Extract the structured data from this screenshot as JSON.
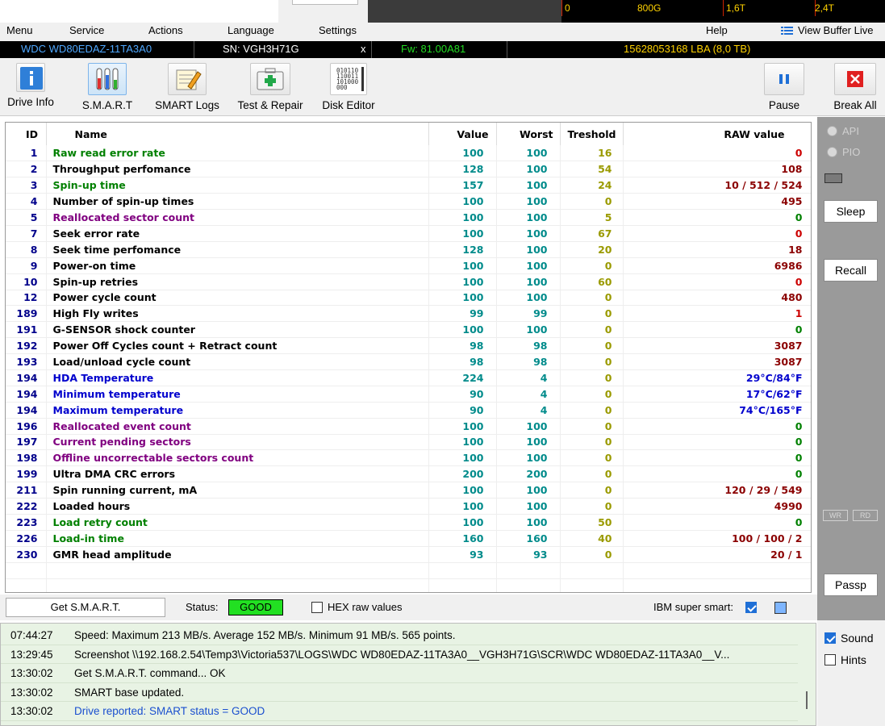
{
  "graph_ticks": [
    "0",
    "800G",
    "1,6T",
    "2,4T"
  ],
  "menu": {
    "items": [
      "Menu",
      "Service",
      "Actions",
      "Language",
      "Settings",
      "Help"
    ],
    "view_buffer": "View Buffer Live"
  },
  "drive": {
    "model": "WDC WD80EDAZ-11TA3A0",
    "sn": "SN: VGH3H71G",
    "close": "x",
    "fw": "Fw: 81.00A81",
    "lba": "15628053168 LBA (8,0 TB)"
  },
  "toolbar": {
    "drive_info": "Drive Info",
    "smart": "S.M.A.R.T",
    "smart_logs": "SMART Logs",
    "test_repair": "Test & Repair",
    "disk_editor": "Disk Editor",
    "pause": "Pause",
    "break_all": "Break All"
  },
  "table": {
    "headers": {
      "id": "ID",
      "name": "Name",
      "value": "Value",
      "worst": "Worst",
      "threshold": "Treshold",
      "raw": "RAW value"
    },
    "rows": [
      {
        "id": "1",
        "name": "Raw read error rate",
        "value": "100",
        "worst": "100",
        "thr": "16",
        "raw": "0",
        "name_color": "#008000",
        "raw_color": "#cc0000"
      },
      {
        "id": "2",
        "name": "Throughput perfomance",
        "value": "128",
        "worst": "100",
        "thr": "54",
        "raw": "108",
        "name_color": "#000000",
        "raw_color": "#8b0000"
      },
      {
        "id": "3",
        "name": "Spin-up time",
        "value": "157",
        "worst": "100",
        "thr": "24",
        "raw": "10 / 512 / 524",
        "name_color": "#008000",
        "raw_color": "#8b0000"
      },
      {
        "id": "4",
        "name": "Number of spin-up times",
        "value": "100",
        "worst": "100",
        "thr": "0",
        "raw": "495",
        "name_color": "#000000",
        "raw_color": "#8b0000"
      },
      {
        "id": "5",
        "name": "Reallocated sector count",
        "value": "100",
        "worst": "100",
        "thr": "5",
        "raw": "0",
        "name_color": "#800080",
        "raw_color": "#008000"
      },
      {
        "id": "7",
        "name": "Seek error rate",
        "value": "100",
        "worst": "100",
        "thr": "67",
        "raw": "0",
        "name_color": "#000000",
        "raw_color": "#cc0000"
      },
      {
        "id": "8",
        "name": "Seek time perfomance",
        "value": "128",
        "worst": "100",
        "thr": "20",
        "raw": "18",
        "name_color": "#000000",
        "raw_color": "#8b0000"
      },
      {
        "id": "9",
        "name": "Power-on time",
        "value": "100",
        "worst": "100",
        "thr": "0",
        "raw": "6986",
        "name_color": "#000000",
        "raw_color": "#8b0000"
      },
      {
        "id": "10",
        "name": "Spin-up retries",
        "value": "100",
        "worst": "100",
        "thr": "60",
        "raw": "0",
        "name_color": "#000000",
        "raw_color": "#cc0000"
      },
      {
        "id": "12",
        "name": "Power cycle count",
        "value": "100",
        "worst": "100",
        "thr": "0",
        "raw": "480",
        "name_color": "#000000",
        "raw_color": "#8b0000"
      },
      {
        "id": "189",
        "name": "High Fly writes",
        "value": "99",
        "worst": "99",
        "thr": "0",
        "raw": "1",
        "name_color": "#000000",
        "raw_color": "#cc0000"
      },
      {
        "id": "191",
        "name": "G-SENSOR shock counter",
        "value": "100",
        "worst": "100",
        "thr": "0",
        "raw": "0",
        "name_color": "#000000",
        "raw_color": "#008000"
      },
      {
        "id": "192",
        "name": "Power Off Cycles count + Retract count",
        "value": "98",
        "worst": "98",
        "thr": "0",
        "raw": "3087",
        "name_color": "#000000",
        "raw_color": "#8b0000"
      },
      {
        "id": "193",
        "name": "Load/unload cycle count",
        "value": "98",
        "worst": "98",
        "thr": "0",
        "raw": "3087",
        "name_color": "#000000",
        "raw_color": "#8b0000"
      },
      {
        "id": "194",
        "name": "HDA Temperature",
        "value": "224",
        "worst": "4",
        "thr": "0",
        "raw": "29°C/84°F",
        "name_color": "#0000cd",
        "raw_color": "#0000cd"
      },
      {
        "id": "194",
        "name": "Minimum temperature",
        "value": "90",
        "worst": "4",
        "thr": "0",
        "raw": "17°C/62°F",
        "name_color": "#0000cd",
        "raw_color": "#0000cd"
      },
      {
        "id": "194",
        "name": "Maximum temperature",
        "value": "90",
        "worst": "4",
        "thr": "0",
        "raw": "74°C/165°F",
        "name_color": "#0000cd",
        "raw_color": "#0000cd"
      },
      {
        "id": "196",
        "name": "Reallocated event count",
        "value": "100",
        "worst": "100",
        "thr": "0",
        "raw": "0",
        "name_color": "#800080",
        "raw_color": "#008000"
      },
      {
        "id": "197",
        "name": "Current pending sectors",
        "value": "100",
        "worst": "100",
        "thr": "0",
        "raw": "0",
        "name_color": "#800080",
        "raw_color": "#008000"
      },
      {
        "id": "198",
        "name": "Offline uncorrectable sectors count",
        "value": "100",
        "worst": "100",
        "thr": "0",
        "raw": "0",
        "name_color": "#800080",
        "raw_color": "#008000"
      },
      {
        "id": "199",
        "name": "Ultra DMA CRC errors",
        "value": "200",
        "worst": "200",
        "thr": "0",
        "raw": "0",
        "name_color": "#000000",
        "raw_color": "#008000"
      },
      {
        "id": "211",
        "name": "Spin running current, mA",
        "value": "100",
        "worst": "100",
        "thr": "0",
        "raw": "120 / 29 / 549",
        "name_color": "#000000",
        "raw_color": "#8b0000"
      },
      {
        "id": "222",
        "name": "Loaded hours",
        "value": "100",
        "worst": "100",
        "thr": "0",
        "raw": "4990",
        "name_color": "#000000",
        "raw_color": "#8b0000"
      },
      {
        "id": "223",
        "name": "Load retry count",
        "value": "100",
        "worst": "100",
        "thr": "50",
        "raw": "0",
        "name_color": "#008000",
        "raw_color": "#008000"
      },
      {
        "id": "226",
        "name": "Load-in time",
        "value": "160",
        "worst": "160",
        "thr": "40",
        "raw": "100 / 100 / 2",
        "name_color": "#008000",
        "raw_color": "#8b0000"
      },
      {
        "id": "230",
        "name": "GMR head amplitude",
        "value": "93",
        "worst": "93",
        "thr": "0",
        "raw": "20 / 1",
        "name_color": "#000000",
        "raw_color": "#8b0000"
      }
    ]
  },
  "right": {
    "api": "API",
    "pio": "PIO",
    "sleep": "Sleep",
    "recall": "Recall",
    "wr": "WR",
    "rd": "RD",
    "passp": "Passp"
  },
  "status": {
    "get_smart": "Get S.M.A.R.T.",
    "status_label": "Status:",
    "status_value": "GOOD",
    "hex_raw": "HEX raw values",
    "ibm": "IBM super smart:"
  },
  "log": [
    {
      "time": "07:44:27",
      "msg": "Speed: Maximum 213 MB/s. Average 152 MB/s. Minimum 91 MB/s. 565 points.",
      "color": "#000000"
    },
    {
      "time": "13:29:45",
      "msg": "Screenshot \\\\192.168.2.54\\Temp3\\Victoria537\\LOGS\\WDC WD80EDAZ-11TA3A0__VGH3H71G\\SCR\\WDC WD80EDAZ-11TA3A0__V...",
      "color": "#000000"
    },
    {
      "time": "13:30:02",
      "msg": "Get S.M.A.R.T. command... OK",
      "color": "#000000"
    },
    {
      "time": "13:30:02",
      "msg": "SMART base updated.",
      "color": "#000000"
    },
    {
      "time": "13:30:02",
      "msg": "Drive reported: SMART status = GOOD",
      "color": "#1a4fcf"
    }
  ],
  "options": {
    "sound": "Sound",
    "hints": "Hints"
  }
}
